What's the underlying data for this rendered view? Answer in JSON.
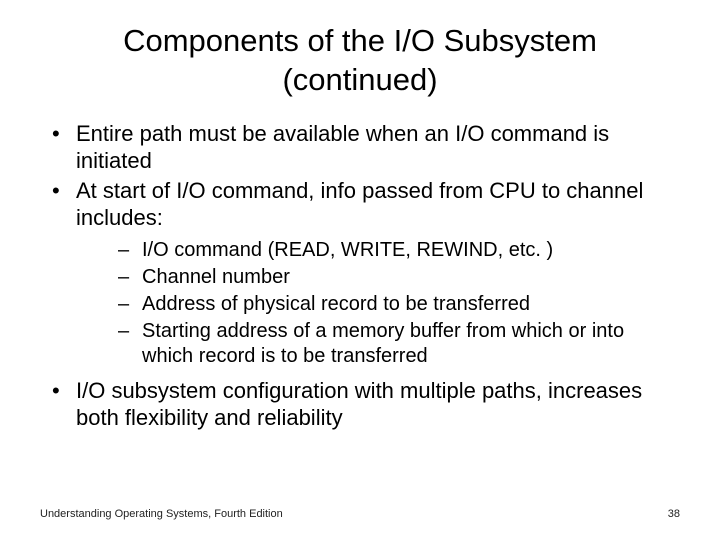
{
  "title": "Components of the I/O Subsystem (continued)",
  "b0": "Entire path must be available when an I/O command is initiated",
  "b1": "At start of I/O command, info passed from CPU to channel includes:",
  "s0": "I/O command (READ, WRITE, REWIND, etc. )",
  "s1": "Channel number",
  "s2": "Address of physical record to be transferred",
  "s3": "Starting address of a memory buffer from which or into which record is to be transferred",
  "b2": "I/O subsystem configuration with multiple paths, increases both flexibility and reliability",
  "footer_left": "Understanding Operating Systems, Fourth Edition",
  "footer_right": "38"
}
